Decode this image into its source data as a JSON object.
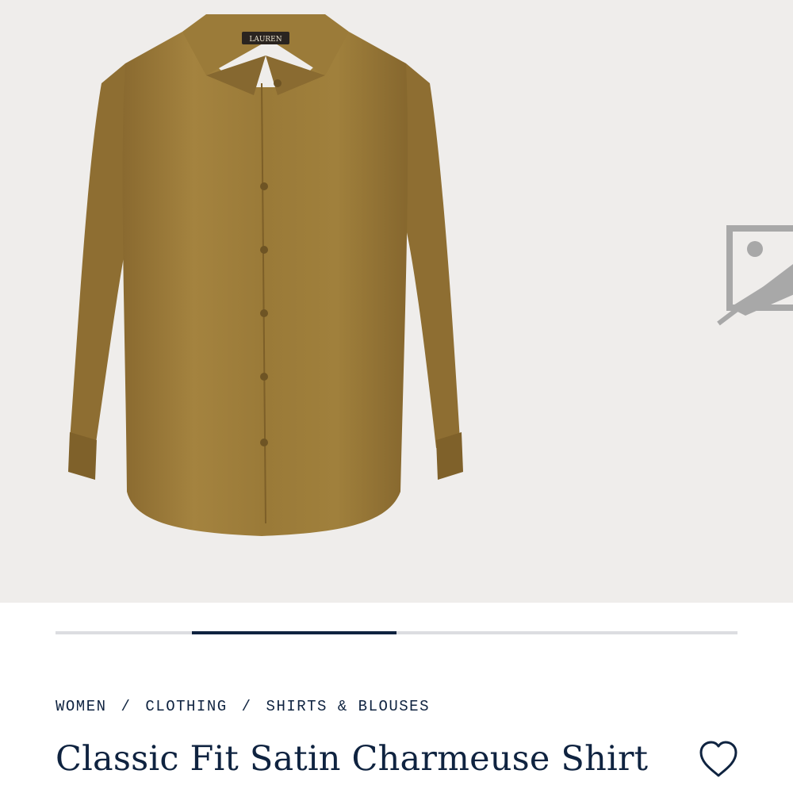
{
  "product": {
    "brand_label": "LAUREN",
    "shirt_color": "#96763a",
    "image_background": "#efedeb"
  },
  "gallery": {
    "progress": {
      "start_fraction": 0.2,
      "end_fraction": 0.5
    },
    "next_image_icon": "image-placeholder-icon"
  },
  "breadcrumb": {
    "items": [
      "WOMEN",
      "CLOTHING",
      "SHIRTS & BLOUSES"
    ],
    "separator": "/"
  },
  "title": "Classic Fit Satin Charmeuse Shirt",
  "wishlist": {
    "icon": "heart-icon"
  },
  "colors": {
    "navy": "#0f2340",
    "track": "#dcdde1"
  }
}
